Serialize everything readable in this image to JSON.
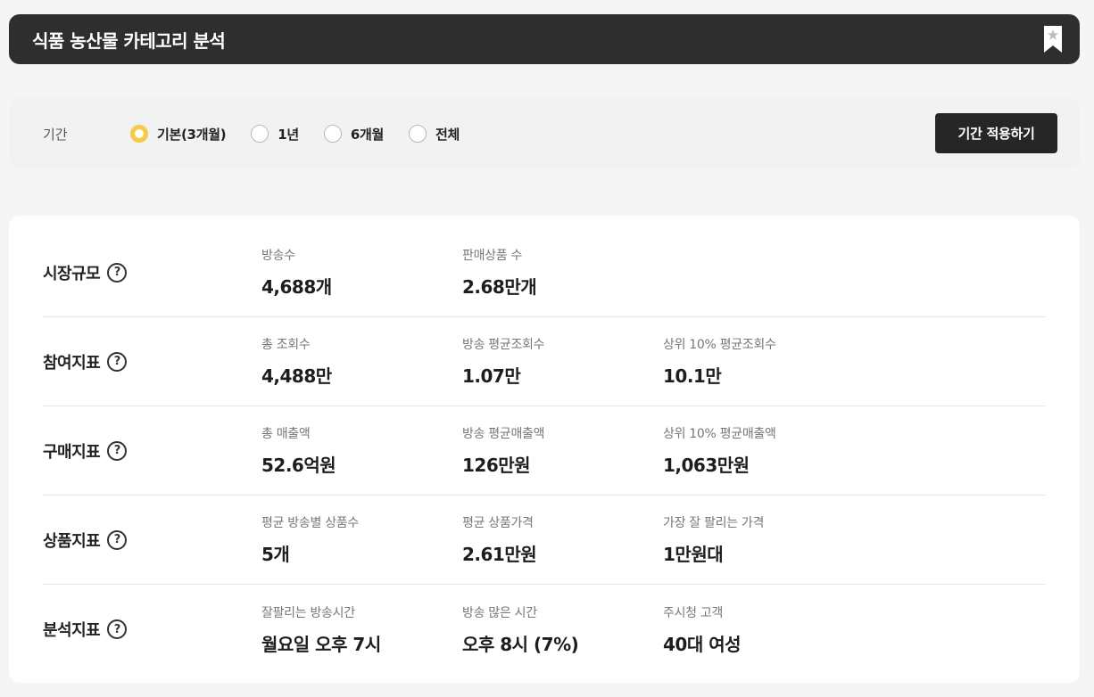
{
  "header": {
    "title": "식품 농산물 카테고리 분석",
    "bookmark_icon": "bookmark-star-icon"
  },
  "filter": {
    "label": "기간",
    "options": [
      {
        "label": "기본(3개월)",
        "selected": true
      },
      {
        "label": "1년",
        "selected": false
      },
      {
        "label": "6개월",
        "selected": false
      },
      {
        "label": "전체",
        "selected": false
      }
    ],
    "apply_label": "기간 적용하기",
    "accent_color": "#f7c948"
  },
  "metrics": {
    "rows": [
      {
        "title": "시장규모",
        "items": [
          {
            "label": "방송수",
            "value": "4,688개"
          },
          {
            "label": "판매상품 수",
            "value": "2.68만개"
          }
        ]
      },
      {
        "title": "참여지표",
        "items": [
          {
            "label": "총 조회수",
            "value": "4,488만"
          },
          {
            "label": "방송 평균조회수",
            "value": "1.07만"
          },
          {
            "label": "상위 10% 평균조회수",
            "value": "10.1만"
          }
        ]
      },
      {
        "title": "구매지표",
        "items": [
          {
            "label": "총 매출액",
            "value": "52.6억원"
          },
          {
            "label": "방송 평균매출액",
            "value": "126만원"
          },
          {
            "label": "상위 10% 평균매출액",
            "value": "1,063만원"
          }
        ]
      },
      {
        "title": "상품지표",
        "items": [
          {
            "label": "평균 방송별 상품수",
            "value": "5개"
          },
          {
            "label": "평균 상품가격",
            "value": "2.61만원"
          },
          {
            "label": "가장 잘 팔리는 가격",
            "value": "1만원대"
          }
        ]
      },
      {
        "title": "분석지표",
        "items": [
          {
            "label": "잘팔리는 방송시간",
            "value": "월요일 오후 7시"
          },
          {
            "label": "방송 많은 시간",
            "value": "오후 8시 (7%)"
          },
          {
            "label": "주시청 고객",
            "value": "40대 여성"
          }
        ]
      }
    ]
  },
  "help_icon": "help-circle-icon",
  "help_glyph": "?"
}
